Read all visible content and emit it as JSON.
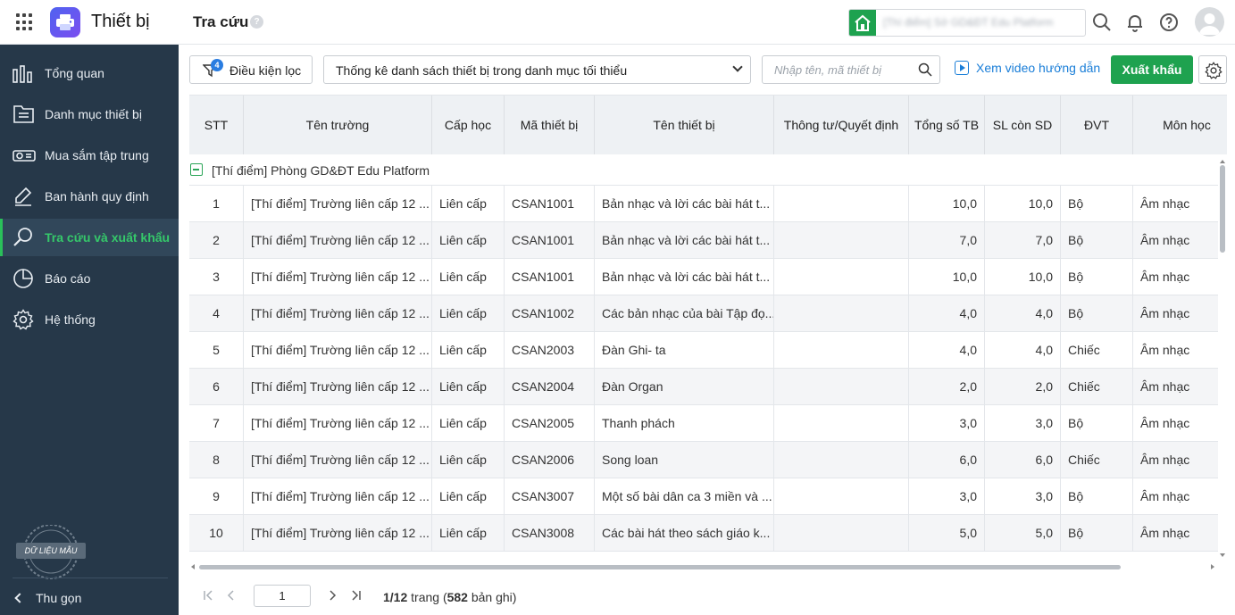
{
  "app": {
    "title": "Thiết bị"
  },
  "header": {
    "page_title": "Tra cứu",
    "help": "?",
    "unit_name": "[Thí điểm] Sở GD&ĐT Edu Platform"
  },
  "sidebar": {
    "items": [
      {
        "label": "Tổng quan",
        "icon": "dashboard-icon"
      },
      {
        "label": "Danh mục thiết bị",
        "icon": "catalog-icon"
      },
      {
        "label": "Mua sắm tập trung",
        "icon": "projector-icon"
      },
      {
        "label": "Ban hành quy định",
        "icon": "edit-document-icon"
      },
      {
        "label": "Tra cứu và xuất khẩu",
        "icon": "search-icon",
        "active": true
      },
      {
        "label": "Báo cáo",
        "icon": "pie-chart-icon"
      },
      {
        "label": "Hệ thống",
        "icon": "gear-icon"
      }
    ],
    "sample_badge": "DỮ LIỆU MẪU",
    "collapse_label": "Thu gọn"
  },
  "toolbar": {
    "filter_label": "Điều kiện lọc",
    "filter_count": "4",
    "report_selected": "Thống kê danh sách thiết bị trong danh mục tối thiểu",
    "search_placeholder": "Nhập tên, mã thiết bị",
    "video_link": "Xem video hướng dẫn",
    "export_label": "Xuất khẩu"
  },
  "table": {
    "columns": [
      "STT",
      "Tên trường",
      "Cấp học",
      "Mã thiết bị",
      "Tên thiết bị",
      "Thông tư/Quyết định",
      "Tổng số TB",
      "SL còn SD",
      "ĐVT",
      "Môn học"
    ],
    "group_label": "[Thí điểm] Phòng GD&ĐT Edu Platform",
    "rows": [
      [
        "1",
        "[Thí điểm] Trường liên cấp 12 ...",
        "Liên cấp",
        "CSAN1001",
        "Bản nhạc và lời các bài hát t...",
        "",
        "10,0",
        "10,0",
        "Bộ",
        "Âm nhạc"
      ],
      [
        "2",
        "[Thí điểm] Trường liên cấp 12 ...",
        "Liên cấp",
        "CSAN1001",
        "Bản nhạc và lời các bài hát t...",
        "",
        "7,0",
        "7,0",
        "Bộ",
        "Âm nhạc"
      ],
      [
        "3",
        "[Thí điểm] Trường liên cấp 12 ...",
        "Liên cấp",
        "CSAN1001",
        "Bản nhạc và lời các bài hát t...",
        "",
        "10,0",
        "10,0",
        "Bộ",
        "Âm nhạc"
      ],
      [
        "4",
        "[Thí điểm] Trường liên cấp 12 ...",
        "Liên cấp",
        "CSAN1002",
        "Các bản nhạc của bài Tập đọ...",
        "",
        "4,0",
        "4,0",
        "Bộ",
        "Âm nhạc"
      ],
      [
        "5",
        "[Thí điểm] Trường liên cấp 12 ...",
        "Liên cấp",
        "CSAN2003",
        "Đàn Ghi- ta",
        "",
        "4,0",
        "4,0",
        "Chiếc",
        "Âm nhạc"
      ],
      [
        "6",
        "[Thí điểm] Trường liên cấp 12 ...",
        "Liên cấp",
        "CSAN2004",
        "Đàn Organ",
        "",
        "2,0",
        "2,0",
        "Chiếc",
        "Âm nhạc"
      ],
      [
        "7",
        "[Thí điểm] Trường liên cấp 12 ...",
        "Liên cấp",
        "CSAN2005",
        "Thanh phách",
        "",
        "3,0",
        "3,0",
        "Bộ",
        "Âm nhạc"
      ],
      [
        "8",
        "[Thí điểm] Trường liên cấp 12 ...",
        "Liên cấp",
        "CSAN2006",
        "Song loan",
        "",
        "6,0",
        "6,0",
        "Chiếc",
        "Âm nhạc"
      ],
      [
        "9",
        "[Thí điểm] Trường liên cấp 12 ...",
        "Liên cấp",
        "CSAN3007",
        "Một số bài dân ca 3 miền và ...",
        "",
        "3,0",
        "3,0",
        "Bộ",
        "Âm nhạc"
      ],
      [
        "10",
        "[Thí điểm] Trường liên cấp 12 ...",
        "Liên cấp",
        "CSAN3008",
        "Các bài hát theo sách giáo k...",
        "",
        "5,0",
        "5,0",
        "Bộ",
        "Âm nhạc"
      ]
    ]
  },
  "pagination": {
    "current_page": "1",
    "total_pages": "1/12",
    "trang_label": "trang (",
    "record_count": "582",
    "record_suffix": "bản ghi)"
  },
  "colors": {
    "sidebar_bg": "#263849",
    "accent_green": "#1ea24f",
    "link_blue": "#1a7ed8"
  }
}
